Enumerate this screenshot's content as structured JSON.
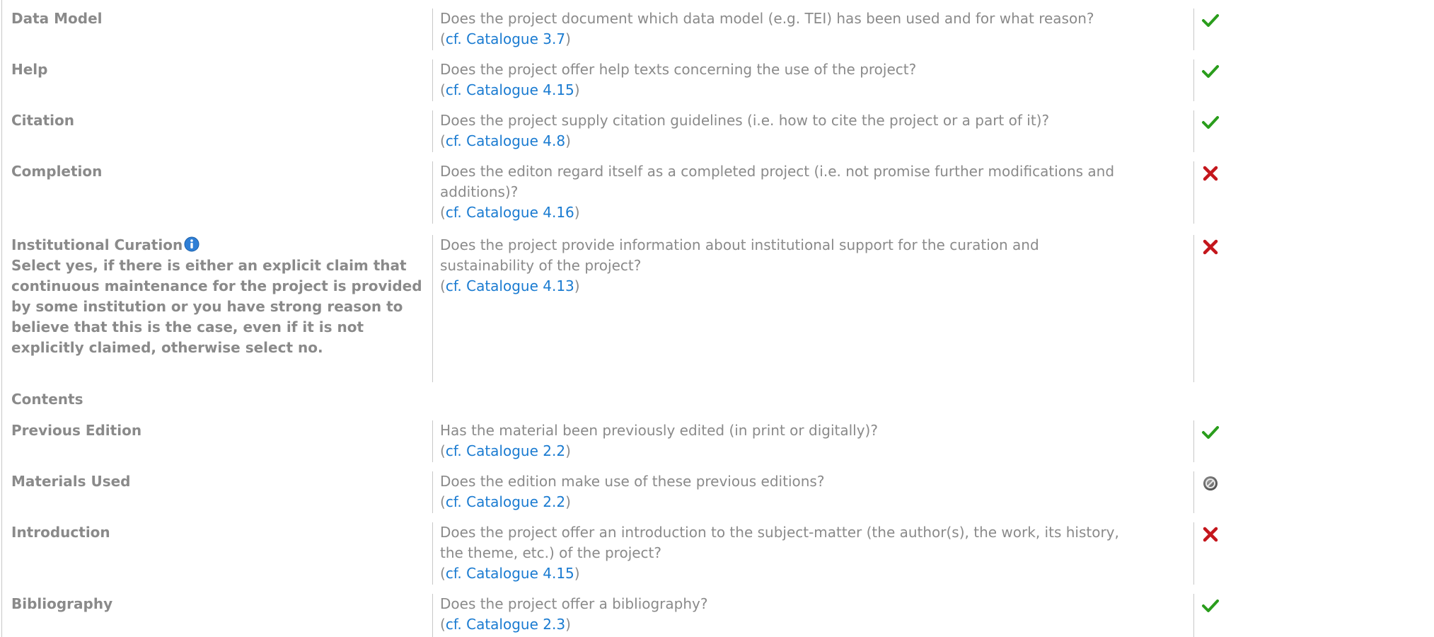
{
  "rows_top": [
    {
      "name": "Data Model",
      "question": "Does the project document which data model (e.g. TEI) has been used and for what reason?",
      "ref_link": "cf. Catalogue 3.7",
      "status": "yes"
    },
    {
      "name": "Help",
      "question": "Does the project offer help texts concerning the use of the project?",
      "ref_link": "cf. Catalogue 4.15",
      "status": "yes"
    },
    {
      "name": "Citation",
      "question": "Does the project supply citation guidelines (i.e. how to cite the project or a part of it)?",
      "ref_link": "cf. Catalogue 4.8",
      "status": "yes"
    },
    {
      "name": "Completion",
      "question_line1": "Does the editon regard itself as a completed project (i.e. not promise further modifications and",
      "question_line2": "additions)?",
      "ref_link": "cf. Catalogue 4.16",
      "status": "no"
    },
    {
      "name": "Institutional Curation",
      "hint": "Select yes, if there is either an explicit claim that continuous maintenance for the project is provided by some institution or you have strong reason to believe that this is the case, even if it is not explicitly claimed, otherwise select no.",
      "question_line1": "Does the project provide information about institutional support for the curation and",
      "question_line2": "sustainability of the project?",
      "ref_link": "cf. Catalogue 4.13",
      "status": "no"
    }
  ],
  "section": {
    "title": "Contents"
  },
  "rows_bottom": [
    {
      "name": "Previous Edition",
      "question": "Has the material been previously edited (in print or digitally)?",
      "ref_link": "cf. Catalogue 2.2",
      "status": "yes"
    },
    {
      "name": "Materials Used",
      "question": "Does the edition make use of these previous editions?",
      "ref_link": "cf. Catalogue 2.2",
      "status": "not-applicable"
    },
    {
      "name": "Introduction",
      "question_line1": "Does the project offer an introduction to the subject-matter (the author(s), the work, its history,",
      "question_line2": "the theme, etc.) of the project?",
      "ref_link": "cf. Catalogue 4.15",
      "status": "no"
    },
    {
      "name": "Bibliography",
      "question": "Does the project offer a bibliography?",
      "ref_link": "cf. Catalogue 2.3",
      "status": "yes"
    }
  ],
  "punct": {
    "open": "(",
    "close": ")"
  },
  "icons": {
    "yes": "check-icon",
    "no": "cross-icon",
    "not-applicable": "not-applicable-icon",
    "info": "info-icon"
  },
  "colors": {
    "check": "#2a9d1c",
    "cross": "#c4161c",
    "link": "#1a7bd1",
    "text": "#8a8a8a",
    "info": "#2f7fd6"
  }
}
